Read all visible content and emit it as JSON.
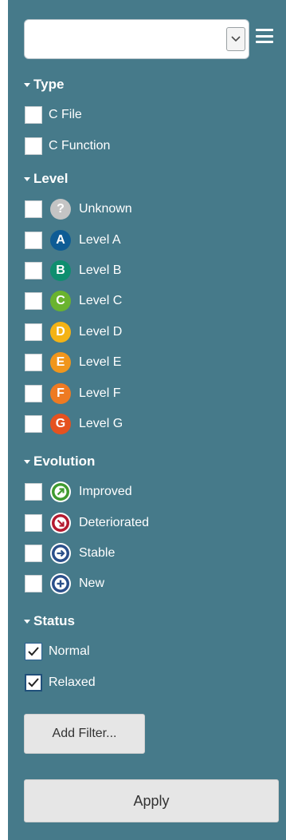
{
  "combo": {
    "value": ""
  },
  "sections": {
    "type": {
      "title": "Type",
      "items": [
        {
          "label": "C File",
          "checked": false
        },
        {
          "label": "C Function",
          "checked": false
        }
      ]
    },
    "level": {
      "title": "Level",
      "items": [
        {
          "label": "Unknown",
          "badge": "?",
          "color": "#c4c4c4"
        },
        {
          "label": "Level A",
          "badge": "A",
          "color": "#0e5c95"
        },
        {
          "label": "Level B",
          "badge": "B",
          "color": "#0f8e6f"
        },
        {
          "label": "Level C",
          "badge": "C",
          "color": "#6ab32f"
        },
        {
          "label": "Level D",
          "badge": "D",
          "color": "#f4b315"
        },
        {
          "label": "Level E",
          "badge": "E",
          "color": "#f0961c"
        },
        {
          "label": "Level F",
          "badge": "F",
          "color": "#ee7a22"
        },
        {
          "label": "Level G",
          "badge": "G",
          "color": "#e5521f"
        }
      ]
    },
    "evolution": {
      "title": "Evolution",
      "items": [
        {
          "label": "Improved",
          "icon": "improved-arrow-icon",
          "color": "#3f9a2f"
        },
        {
          "label": "Deteriorated",
          "icon": "deteriorated-arrow-icon",
          "color": "#b3192f"
        },
        {
          "label": "Stable",
          "icon": "stable-arrow-icon",
          "color": "#2a4f8a"
        },
        {
          "label": "New",
          "icon": "new-plus-icon",
          "color": "#2a4f8a"
        }
      ]
    },
    "status": {
      "title": "Status",
      "items": [
        {
          "label": "Normal",
          "checked": true
        },
        {
          "label": "Relaxed",
          "checked": true
        }
      ]
    }
  },
  "buttons": {
    "add_filter": "Add Filter...",
    "apply": "Apply"
  }
}
